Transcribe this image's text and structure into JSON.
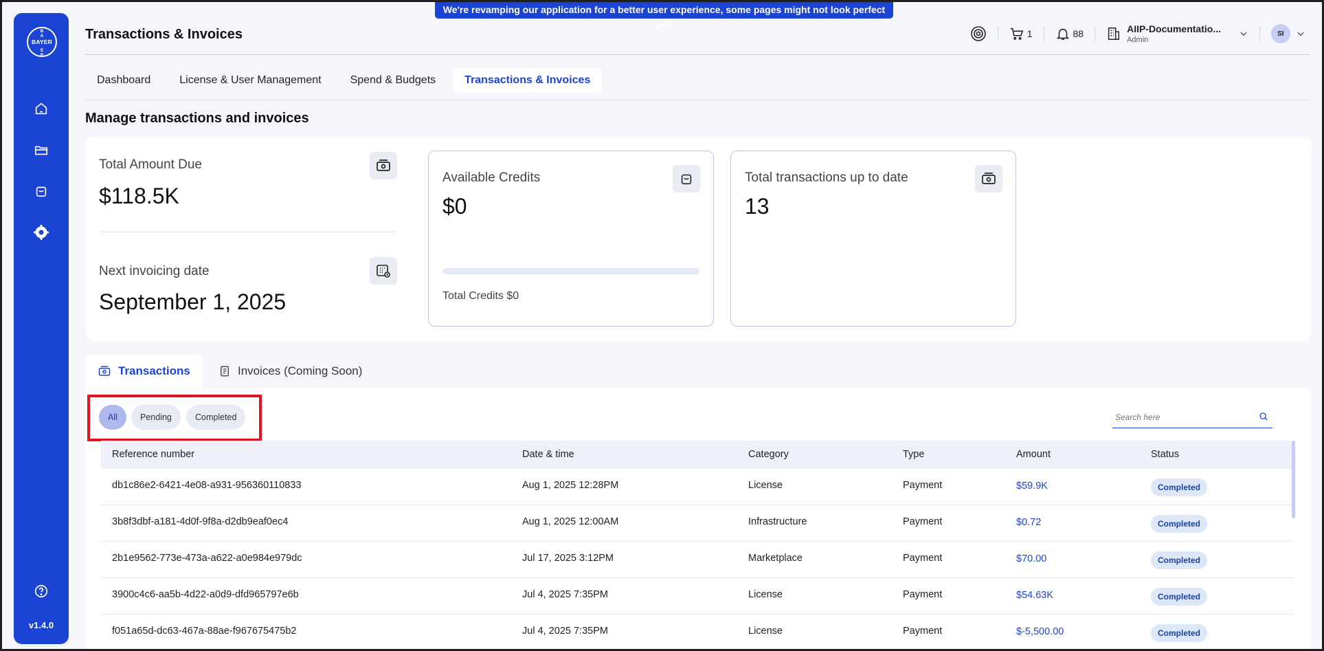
{
  "banner": {
    "text": "We're revamping our application for a better user experience, some pages might not look perfect yet!"
  },
  "sidebar": {
    "logo_horizontal": "BAYER",
    "logo_vertical": "BAYER",
    "version": "v1.4.0",
    "items": [
      {
        "name": "home",
        "icon": "home-icon"
      },
      {
        "name": "projects",
        "icon": "folder-icon"
      },
      {
        "name": "marketplace",
        "icon": "bag-icon"
      },
      {
        "name": "settings",
        "icon": "gear-icon"
      }
    ],
    "help_icon": "help-icon"
  },
  "header": {
    "title": "Transactions & Invoices",
    "cart_count": "1",
    "notifications_count": "88",
    "account_name": "AIIP-Documentatio...",
    "account_role": "Admin",
    "user_initials": "SI"
  },
  "nav": {
    "tabs": [
      {
        "label": "Dashboard"
      },
      {
        "label": "License & User Management"
      },
      {
        "label": "Spend & Budgets"
      },
      {
        "label": "Transactions & Invoices",
        "active": true
      }
    ]
  },
  "section_title": "Manage transactions and invoices",
  "summary": {
    "total_due_label": "Total Amount Due",
    "total_due_value": "$118.5K",
    "next_invoice_label": "Next invoicing date",
    "next_invoice_value": "September 1, 2025",
    "credits_label": "Available Credits",
    "credits_value": "$0",
    "credits_progress": 0,
    "total_credits_text": "Total Credits $0",
    "transactions_label": "Total transactions up to date",
    "transactions_value": "13"
  },
  "subtabs": {
    "transactions": "Transactions",
    "invoices": "Invoices (Coming Soon)"
  },
  "filters": [
    {
      "label": "All",
      "active": true
    },
    {
      "label": "Pending"
    },
    {
      "label": "Completed"
    }
  ],
  "search": {
    "placeholder": "Search here"
  },
  "table": {
    "columns": [
      "Reference number",
      "Date & time",
      "Category",
      "Type",
      "Amount",
      "Status"
    ],
    "rows": [
      {
        "ref": "db1c86e2-6421-4e08-a931-956360110833",
        "date": "Aug 1, 2025 12:28PM",
        "category": "License",
        "type": "Payment",
        "amount": "$59.9K",
        "status": "Completed"
      },
      {
        "ref": "3b8f3dbf-a181-4d0f-9f8a-d2db9eaf0ec4",
        "date": "Aug 1, 2025 12:00AM",
        "category": "Infrastructure",
        "type": "Payment",
        "amount": "$0.72",
        "status": "Completed"
      },
      {
        "ref": "2b1e9562-773e-473a-a622-a0e984e979dc",
        "date": "Jul 17, 2025 3:12PM",
        "category": "Marketplace",
        "type": "Payment",
        "amount": "$70.00",
        "status": "Completed"
      },
      {
        "ref": "3900c4c6-aa5b-4d22-a0d9-dfd965797e6b",
        "date": "Jul 4, 2025 7:35PM",
        "category": "License",
        "type": "Payment",
        "amount": "$54.63K",
        "status": "Completed"
      },
      {
        "ref": "f051a65d-dc63-467a-88ae-f967675475b2",
        "date": "Jul 4, 2025 7:35PM",
        "category": "License",
        "type": "Payment",
        "amount": "$-5,500.00",
        "status": "Completed"
      }
    ]
  },
  "colors": {
    "accent": "#1c44d4",
    "highlight": "#e0141e",
    "badge_bg": "#dce8f8"
  }
}
